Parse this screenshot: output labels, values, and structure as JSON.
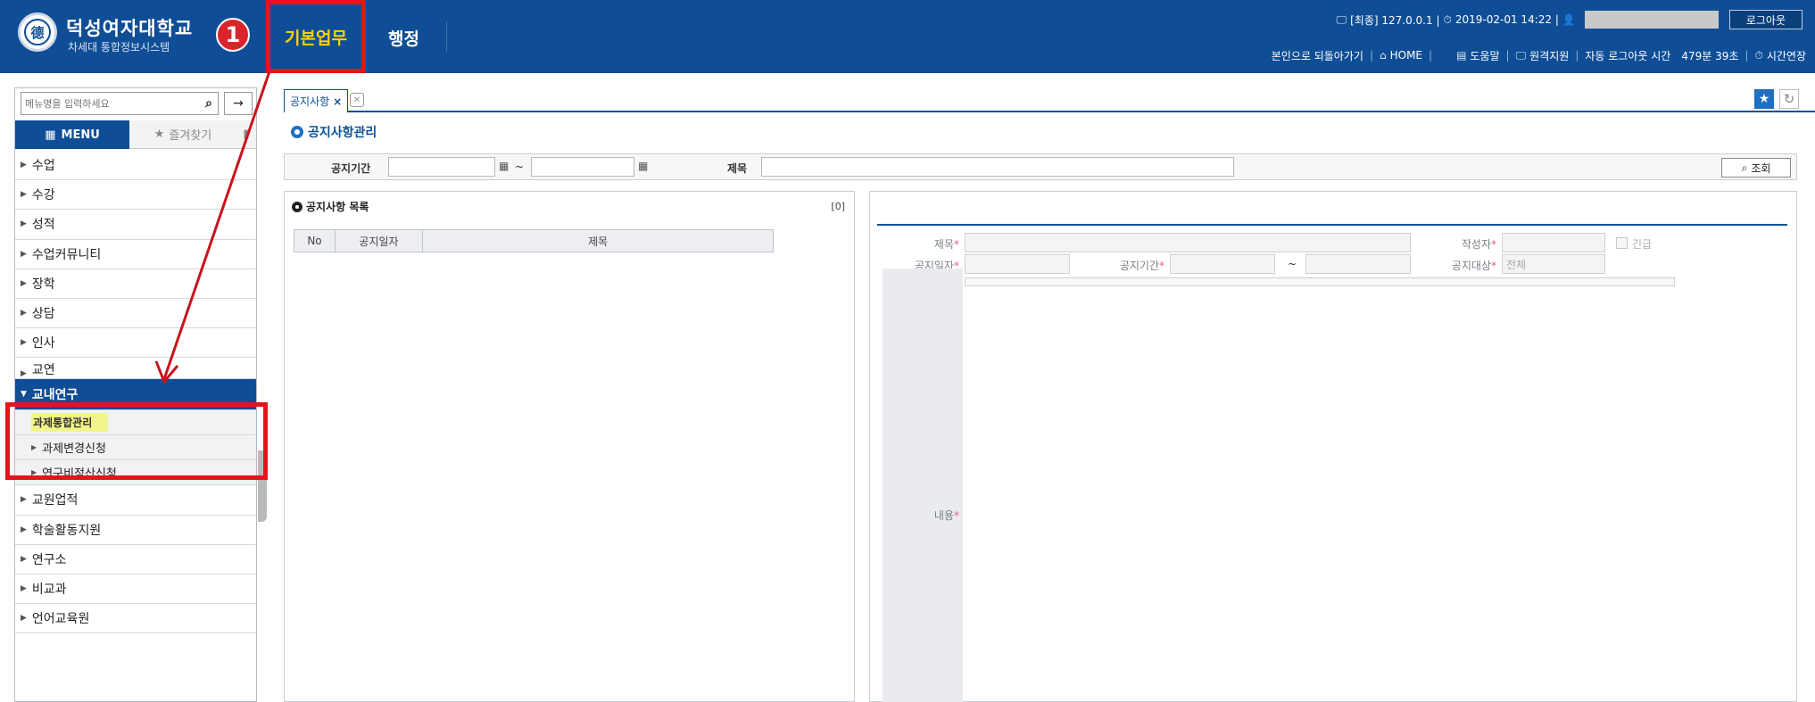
{
  "header": {
    "univ_name": "덕성여자대학교",
    "univ_sub": "차세대 통합정보시스템",
    "logo_glyph": "德",
    "annotation_badge": "1",
    "nav": [
      {
        "label": "기본업무",
        "active": true
      },
      {
        "label": "행정",
        "active": false
      }
    ],
    "line1": {
      "ip": "[최종] 127.0.0.1 |",
      "datetime": "2019-02-01 14:22 |",
      "logout": "로그아웃"
    },
    "line2": {
      "back_self": "본인으로 되돌아가기",
      "home": "HOME",
      "help": "도움말",
      "remote": "원격지원",
      "auto_logout": "자동 로그아웃 시간",
      "remaining": "479분 39초",
      "extend": "시간연장"
    }
  },
  "sidebar": {
    "search_placeholder": "메뉴명을 입력하세요",
    "tab_menu": "MENU",
    "tab_fav": "즐겨찾기",
    "items_before": [
      "수업",
      "수강",
      "성적",
      "수업커뮤니티",
      "장학",
      "상담",
      "인사",
      "교연"
    ],
    "open_item": "교내연구",
    "sub_items": [
      {
        "label": "과제통합관리",
        "active": true
      },
      {
        "label": "과제변경신청",
        "active": false
      },
      {
        "label": "연구비정산신청",
        "active": false
      }
    ],
    "items_after": [
      "교원업적",
      "학술활동지원",
      "연구소",
      "비교과",
      "언어교육원"
    ]
  },
  "content": {
    "tab_label": "공지사항",
    "tab_close": "×",
    "section_title": "공지사항관리",
    "search": {
      "period_label": "공지기간",
      "tilde": "~",
      "subject_label": "제목",
      "inquiry_button": "조회"
    },
    "list": {
      "title": "공지사항 목록",
      "count": "[0]",
      "columns": [
        "No",
        "공지일자",
        "제목"
      ]
    },
    "detail": {
      "subject_label": "제목",
      "author_label": "작성자",
      "urgent_label": "긴급",
      "date_label": "공지일자",
      "period_label": "공지기간",
      "tilde": "~",
      "target_label": "공지대상",
      "target_value": "전체",
      "body_label": "내용",
      "required_mark": "*"
    }
  },
  "colors": {
    "header_bg": "#0f4e96",
    "nav_active": "#ffd200",
    "annotation_red": "#e3141b",
    "submenu_highlight": "#f1f58c"
  }
}
